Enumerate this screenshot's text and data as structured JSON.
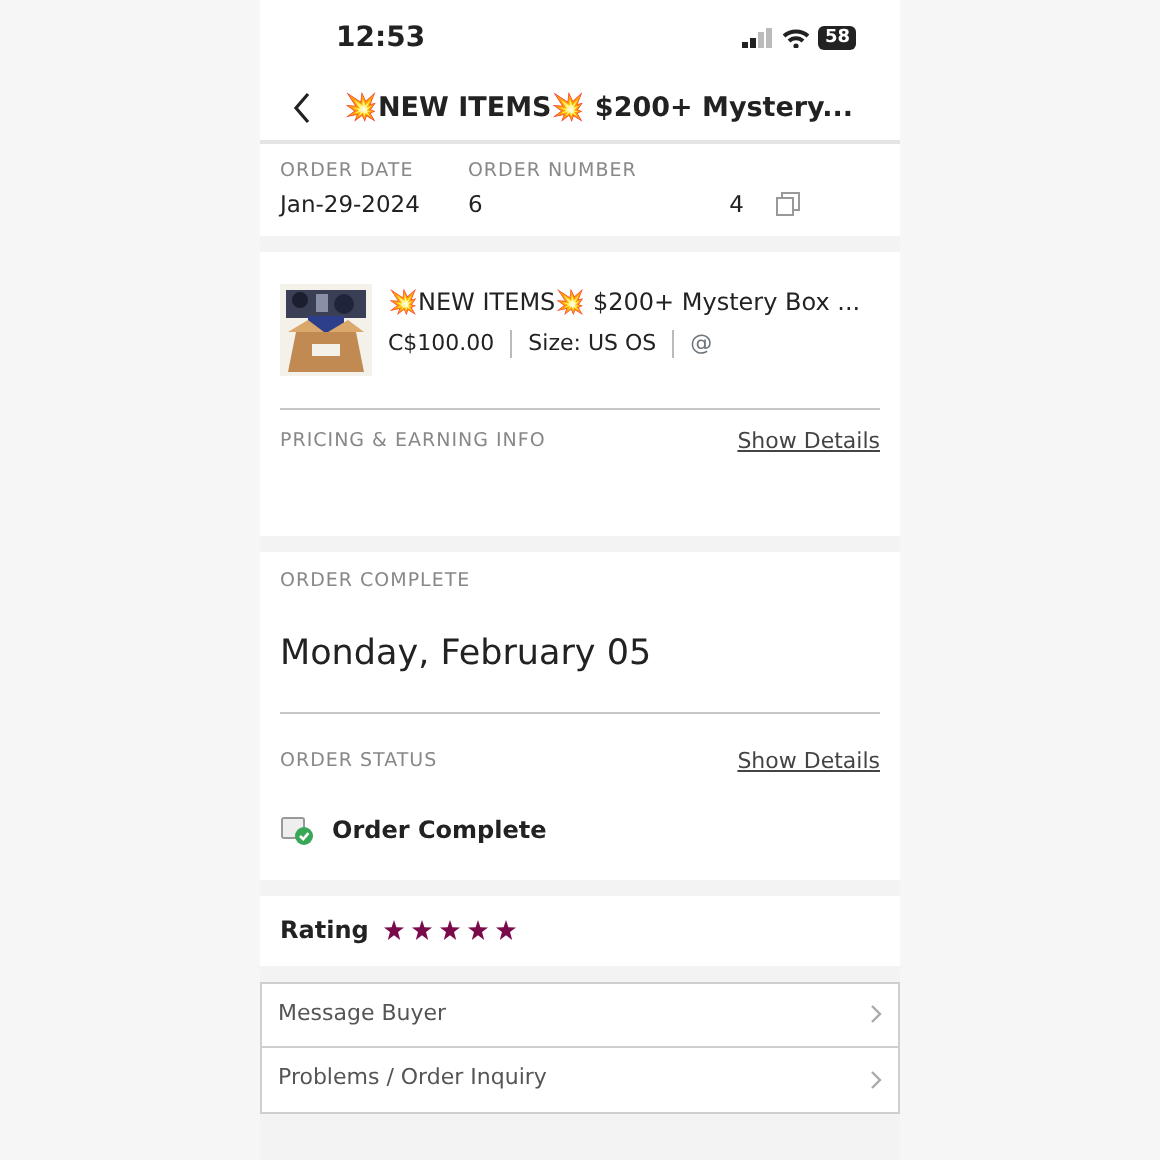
{
  "status_bar": {
    "time": "12:53",
    "battery": "58"
  },
  "header": {
    "title": "💥NEW ITEMS💥 $200+ Mystery..."
  },
  "order_info": {
    "date_label": "ORDER DATE",
    "date": "Jan-29-2024",
    "number_label": "ORDER NUMBER",
    "number_start": "6",
    "number_end": "4"
  },
  "item": {
    "kind": "picture",
    "title": "💥NEW ITEMS💥 $200+ Mystery Box ...",
    "price": "C$100.00",
    "size": "Size: US OS",
    "seller": "@"
  },
  "pricing": {
    "label": "PRICING & EARNING INFO",
    "link": "Show Details"
  },
  "completion": {
    "label": "ORDER COMPLETE",
    "date": "Monday, February 05"
  },
  "status": {
    "label": "ORDER STATUS",
    "link": "Show Details",
    "text": "Order Complete"
  },
  "rating": {
    "label": "Rating",
    "stars": 5
  },
  "actions": [
    {
      "label": "Message Buyer"
    },
    {
      "label": "Problems / Order Inquiry"
    }
  ]
}
